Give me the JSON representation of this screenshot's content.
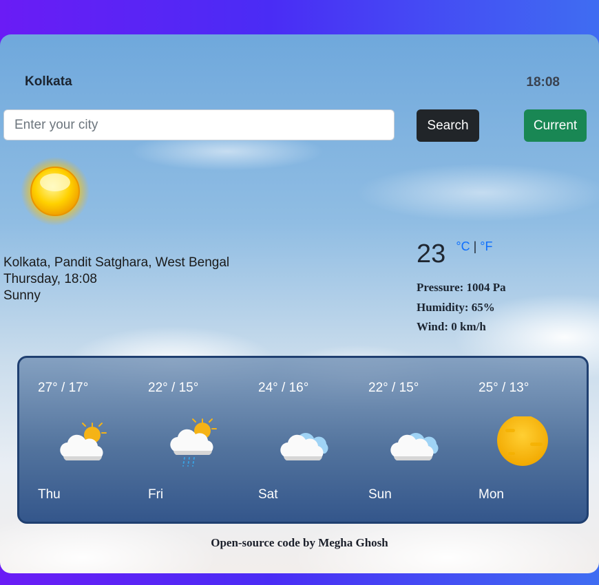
{
  "header": {
    "city": "Kolkata",
    "time": "18:08"
  },
  "search": {
    "placeholder": "Enter your city",
    "value": "",
    "search_label": "Search",
    "current_label": "Current"
  },
  "current": {
    "icon": "sun-icon",
    "location": "Kolkata, Pandit Satghara, West Bengal",
    "day_time": "Thursday, 18:08",
    "condition": "Sunny",
    "temperature": "23",
    "unit_c": "°C",
    "unit_sep": "|",
    "unit_f": "°F",
    "pressure": "Pressure: 1004 Pa",
    "humidity": "Humidity: 65%",
    "wind": "Wind: 0 km/h"
  },
  "forecast": [
    {
      "temp": "27° / 17°",
      "day": "Thu",
      "icon": "partly-cloudy-icon"
    },
    {
      "temp": "22° / 15°",
      "day": "Fri",
      "icon": "rain-partly-cloudy-icon"
    },
    {
      "temp": "24° / 16°",
      "day": "Sat",
      "icon": "cloud-icon"
    },
    {
      "temp": "22° / 15°",
      "day": "Sun",
      "icon": "cloud-icon"
    },
    {
      "temp": "25° / 13°",
      "day": "Mon",
      "icon": "sun-icon"
    }
  ],
  "footer": {
    "text": "Open-source code by Megha Ghosh"
  },
  "colors": {
    "search_button": "#212529",
    "current_button": "#198754",
    "forecast_border": "#1f3f70",
    "unit_link": "#0d6efd"
  }
}
